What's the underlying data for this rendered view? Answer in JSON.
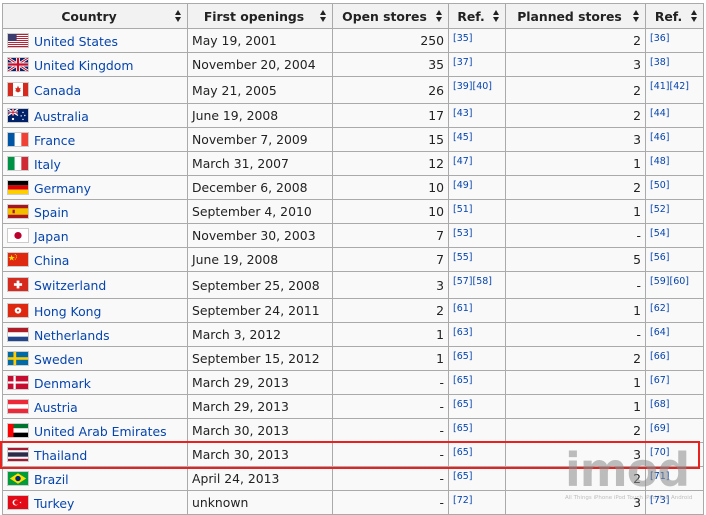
{
  "headers": {
    "country": "Country",
    "first_openings": "First openings",
    "open_stores": "Open stores",
    "ref": "Ref.",
    "planned_stores": "Planned stores",
    "ref2": "Ref."
  },
  "rows": [
    {
      "country": "United States",
      "flag": "us",
      "first": "May 19, 2001",
      "open": "250",
      "ref1": "[35]",
      "planned": "2",
      "ref2": "[36]"
    },
    {
      "country": "United Kingdom",
      "flag": "uk",
      "first": "November 20, 2004",
      "open": "35",
      "ref1": "[37]",
      "planned": "3",
      "ref2": "[38]"
    },
    {
      "country": "Canada",
      "flag": "ca",
      "first": "May 21, 2005",
      "open": "26",
      "ref1": "[39][40]",
      "planned": "2",
      "ref2": "[41][42]"
    },
    {
      "country": "Australia",
      "flag": "au",
      "first": "June 19, 2008",
      "open": "17",
      "ref1": "[43]",
      "planned": "2",
      "ref2": "[44]"
    },
    {
      "country": "France",
      "flag": "fr",
      "first": "November 7, 2009",
      "open": "15",
      "ref1": "[45]",
      "planned": "3",
      "ref2": "[46]"
    },
    {
      "country": "Italy",
      "flag": "it",
      "first": "March 31, 2007",
      "open": "12",
      "ref1": "[47]",
      "planned": "1",
      "ref2": "[48]"
    },
    {
      "country": "Germany",
      "flag": "de",
      "first": "December 6, 2008",
      "open": "10",
      "ref1": "[49]",
      "planned": "2",
      "ref2": "[50]"
    },
    {
      "country": "Spain",
      "flag": "es",
      "first": "September 4, 2010",
      "open": "10",
      "ref1": "[51]",
      "planned": "1",
      "ref2": "[52]"
    },
    {
      "country": "Japan",
      "flag": "jp",
      "first": "November 30, 2003",
      "open": "7",
      "ref1": "[53]",
      "planned": "-",
      "ref2": "[54]"
    },
    {
      "country": "China",
      "flag": "cn",
      "first": "June 19, 2008",
      "open": "7",
      "ref1": "[55]",
      "planned": "5",
      "ref2": "[56]"
    },
    {
      "country": "Switzerland",
      "flag": "ch",
      "first": "September 25, 2008",
      "open": "3",
      "ref1": "[57][58]",
      "planned": "-",
      "ref2": "[59][60]"
    },
    {
      "country": "Hong Kong",
      "flag": "hk",
      "first": "September 24, 2011",
      "open": "2",
      "ref1": "[61]",
      "planned": "1",
      "ref2": "[62]"
    },
    {
      "country": "Netherlands",
      "flag": "nl",
      "first": "March 3, 2012",
      "open": "1",
      "ref1": "[63]",
      "planned": "-",
      "ref2": "[64]"
    },
    {
      "country": "Sweden",
      "flag": "se",
      "first": "September 15, 2012",
      "open": "1",
      "ref1": "[65]",
      "planned": "2",
      "ref2": "[66]"
    },
    {
      "country": "Denmark",
      "flag": "dk",
      "first": "March 29, 2013",
      "open": "-",
      "ref1": "[65]",
      "planned": "1",
      "ref2": "[67]"
    },
    {
      "country": "Austria",
      "flag": "at",
      "first": "March 29, 2013",
      "open": "-",
      "ref1": "[65]",
      "planned": "1",
      "ref2": "[68]"
    },
    {
      "country": "United Arab Emirates",
      "flag": "ae",
      "first": "March 30, 2013",
      "open": "-",
      "ref1": "[65]",
      "planned": "2",
      "ref2": "[69]"
    },
    {
      "country": "Thailand",
      "flag": "th",
      "first": "March 30, 2013",
      "open": "-",
      "ref1": "[65]",
      "planned": "3",
      "ref2": "[70]"
    },
    {
      "country": "Brazil",
      "flag": "br",
      "first": "April 24, 2013",
      "open": "-",
      "ref1": "[65]",
      "planned": "2",
      "ref2": "[71]"
    },
    {
      "country": "Turkey",
      "flag": "tr",
      "first": "unknown",
      "open": "-",
      "ref1": "[72]",
      "planned": "3",
      "ref2": "[73]"
    }
  ],
  "highlight_row": "Thailand",
  "highlight_color": "#e8231f",
  "link_color": "#0645ad",
  "watermark": {
    "logo": "imod",
    "tagline": "All Things iPhone iPod Touch iPad iPad Android"
  }
}
